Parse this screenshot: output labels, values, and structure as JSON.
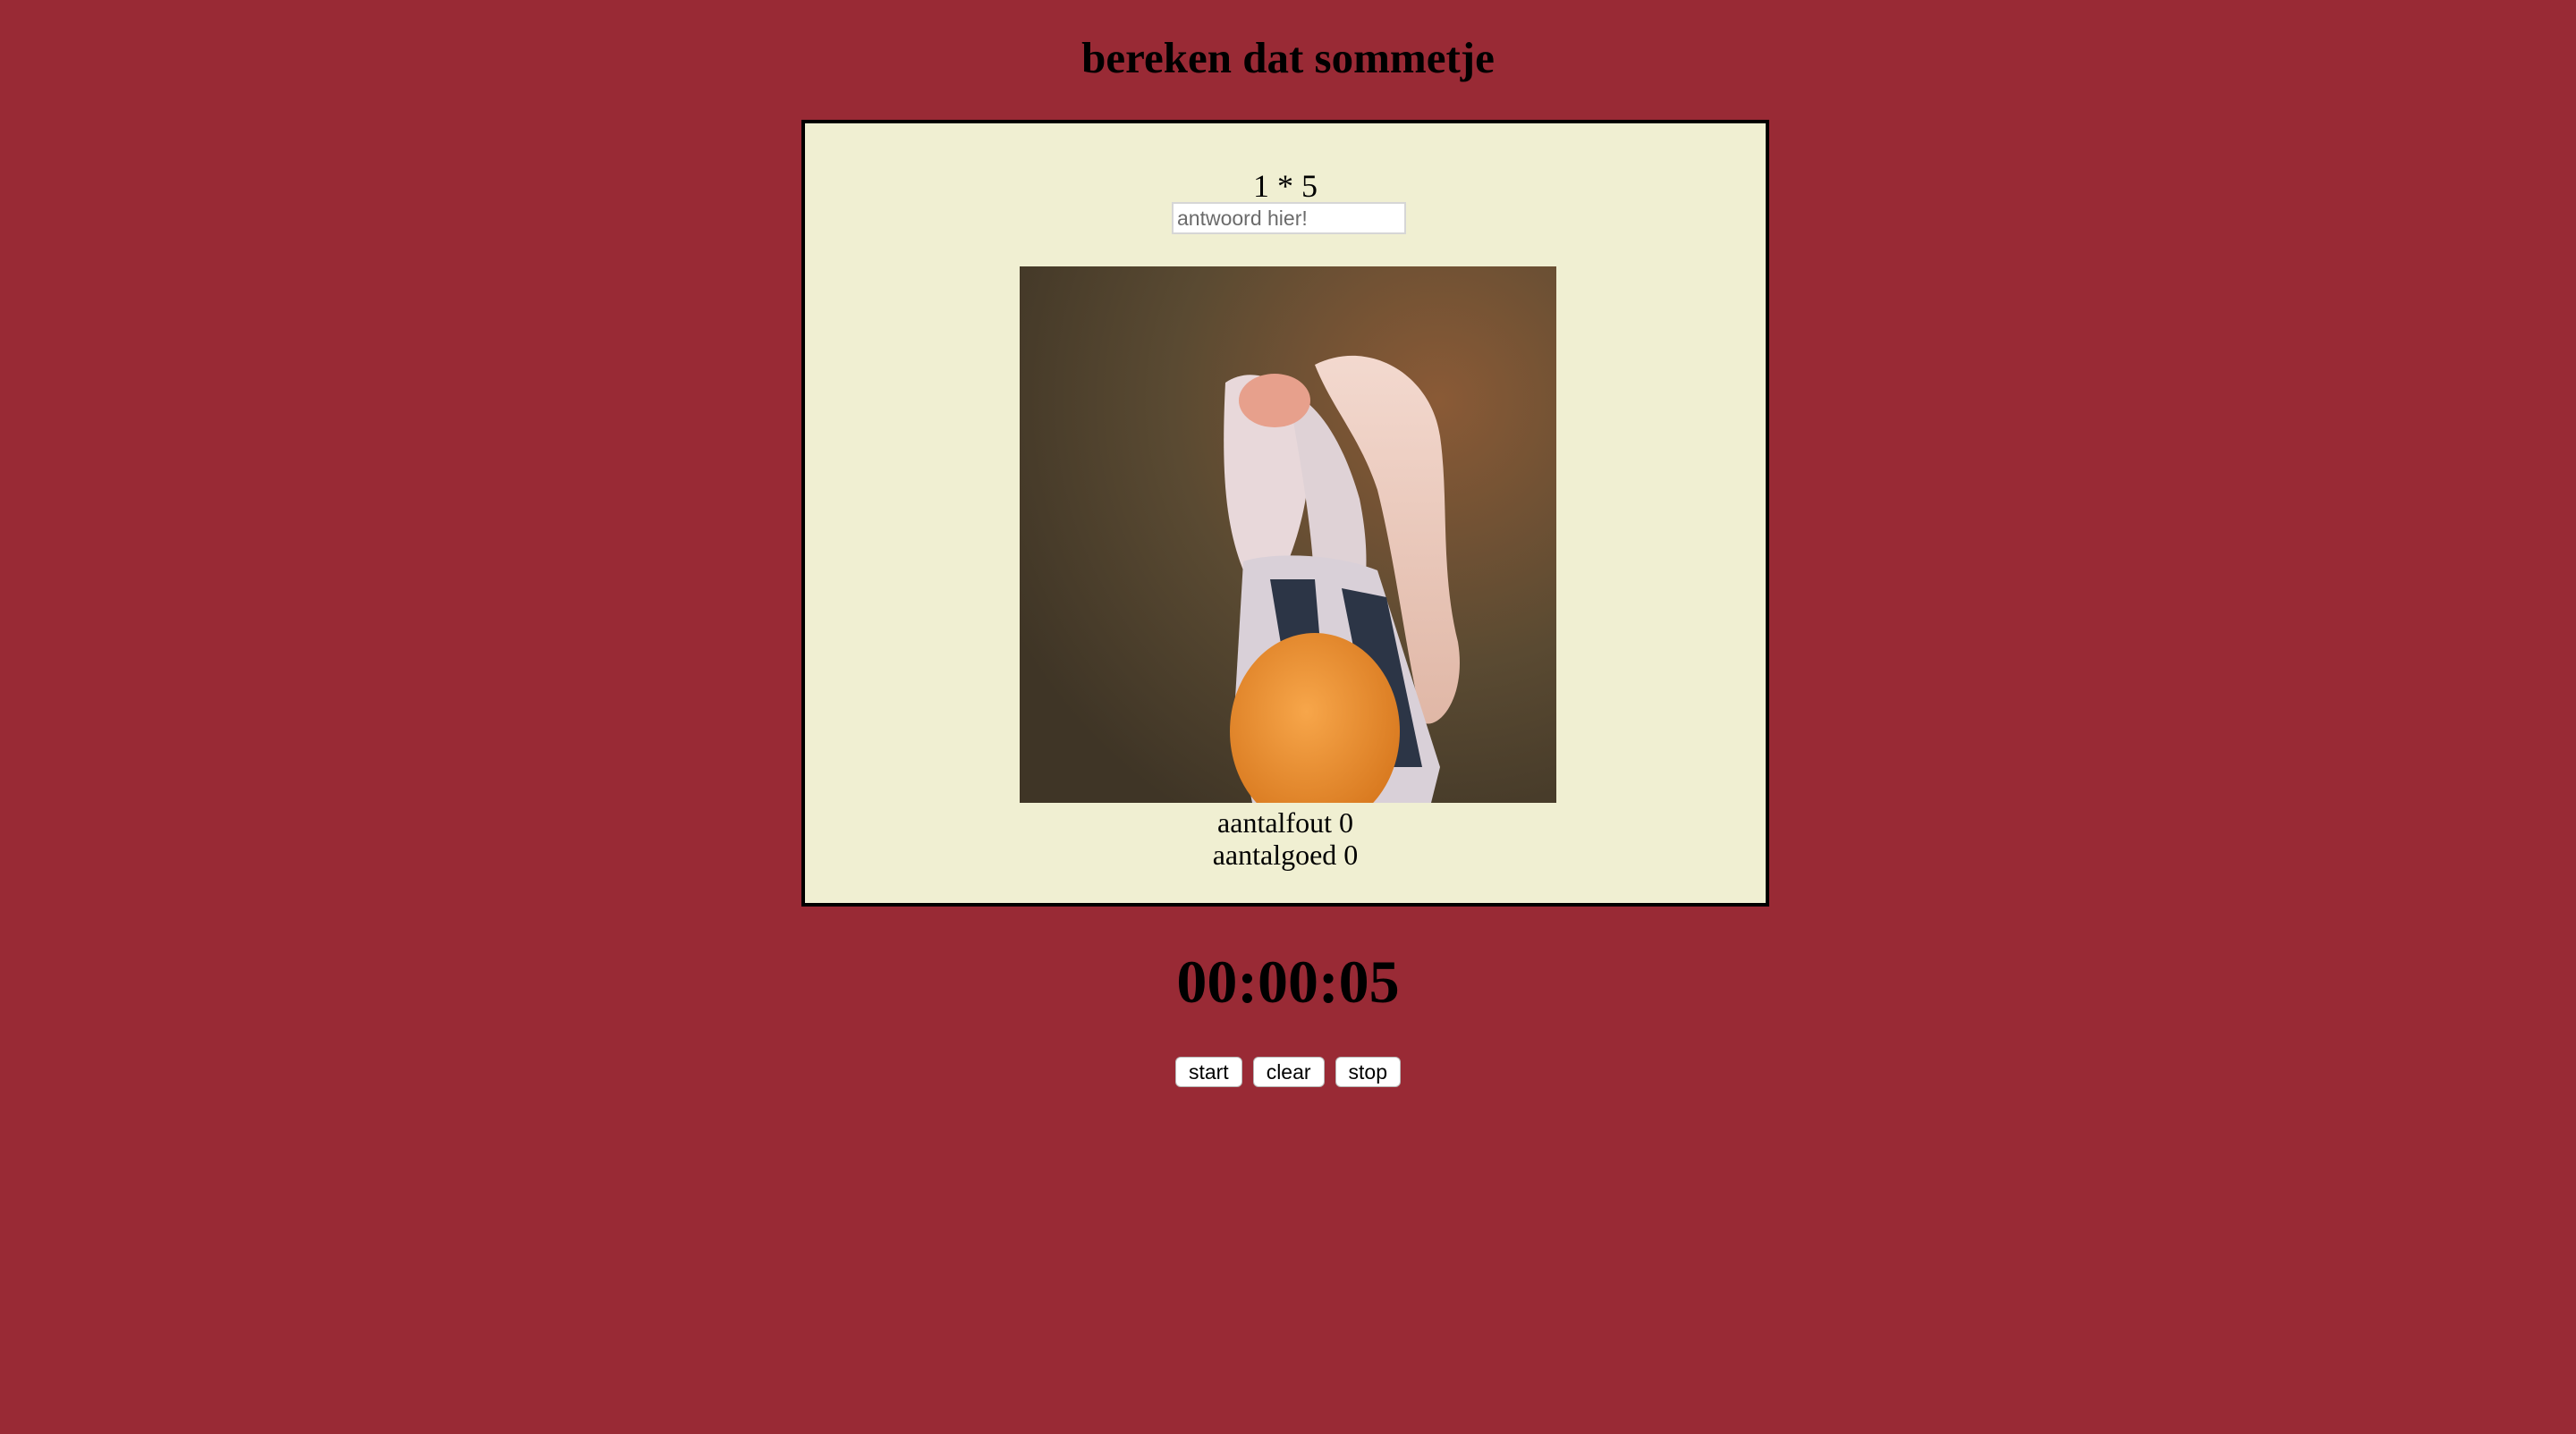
{
  "page": {
    "title": "bereken dat sommetje",
    "background_color": "#992a35"
  },
  "quiz": {
    "sum": "1 * 5",
    "answer_value": "",
    "answer_placeholder": "antwoord hier!",
    "image_icon": "celebration-gif",
    "wrong_label": "aantalfout",
    "wrong_count": "0",
    "right_label": "aantalgoed",
    "right_count": "0",
    "panel_color": "#f0efd2"
  },
  "timer": {
    "display": "00:00:05"
  },
  "controls": {
    "start_label": "start",
    "clear_label": "clear",
    "stop_label": "stop"
  }
}
